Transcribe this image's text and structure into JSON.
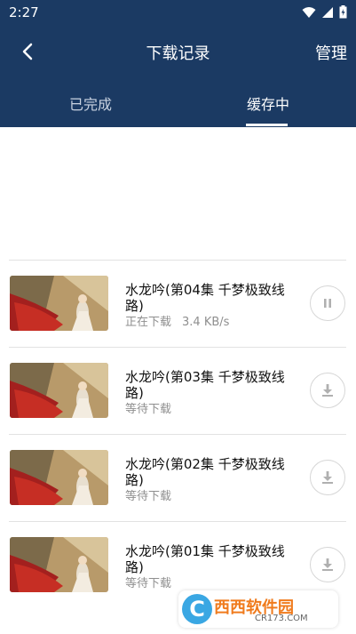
{
  "status_bar": {
    "time": "2:27"
  },
  "header": {
    "title": "下载记录",
    "manage_label": "管理",
    "bg_color": "#1b3a63"
  },
  "tabs": [
    {
      "label": "已完成",
      "active": false
    },
    {
      "label": "缓存中",
      "active": true
    }
  ],
  "downloads": [
    {
      "title": "水龙吟(第04集 千梦极致线路)",
      "status": "正在下载",
      "speed": "3.4 KB/s",
      "action_icon": "pause-icon"
    },
    {
      "title": "水龙吟(第03集 千梦极致线路)",
      "status": "等待下载",
      "speed": "",
      "action_icon": "download-icon"
    },
    {
      "title": "水龙吟(第02集 千梦极致线路)",
      "status": "等待下载",
      "speed": "",
      "action_icon": "download-icon"
    },
    {
      "title": "水龙吟(第01集 千梦极致线路)",
      "status": "等待下载",
      "speed": "",
      "action_icon": "download-icon"
    }
  ],
  "watermark": {
    "text": "西西软件园",
    "sub": "CR173.COM",
    "logo": "C"
  }
}
